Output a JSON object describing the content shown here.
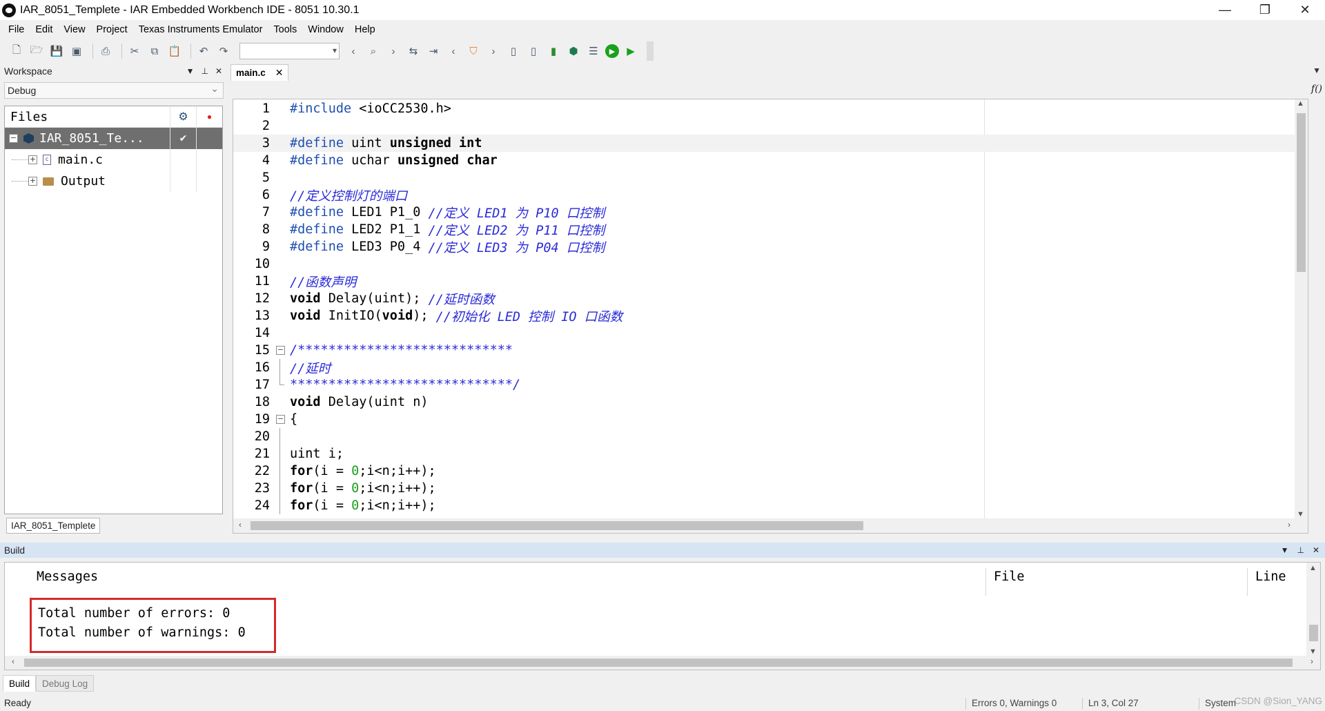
{
  "window": {
    "title": "IAR_8051_Templete - IAR Embedded Workbench IDE - 8051 10.30.1",
    "minimize": "—",
    "maximize": "❐",
    "close": "✕"
  },
  "menu": [
    "File",
    "Edit",
    "View",
    "Project",
    "Texas Instruments Emulator",
    "Tools",
    "Window",
    "Help"
  ],
  "workspace": {
    "title": "Workspace",
    "configuration": "Debug",
    "tree_header": "Files",
    "project": "IAR_8051_Te...",
    "items": [
      "main.c",
      "Output"
    ],
    "tab": "IAR_8051_Templete",
    "icons": {
      "settings": "gear-icon",
      "breakpoint": "red-dot-icon",
      "checked": "check-icon"
    }
  },
  "editor": {
    "tab": "main.c",
    "func_button": "f()",
    "lines": [
      {
        "n": "1",
        "fold": "",
        "tokens": [
          {
            "t": "pp",
            "v": "#include"
          },
          {
            "t": "tx",
            "v": " <ioCC2530.h>"
          }
        ]
      },
      {
        "n": "2",
        "fold": "",
        "tokens": []
      },
      {
        "n": "3",
        "fold": "",
        "tokens": [
          {
            "t": "pp",
            "v": "#define"
          },
          {
            "t": "tx",
            "v": " uint "
          },
          {
            "t": "kw",
            "v": "unsigned"
          },
          {
            "t": "tx",
            "v": " "
          },
          {
            "t": "kw",
            "v": "int"
          }
        ]
      },
      {
        "n": "4",
        "fold": "",
        "tokens": [
          {
            "t": "pp",
            "v": "#define"
          },
          {
            "t": "tx",
            "v": " uchar "
          },
          {
            "t": "kw",
            "v": "unsigned"
          },
          {
            "t": "tx",
            "v": " "
          },
          {
            "t": "kw",
            "v": "char"
          }
        ]
      },
      {
        "n": "5",
        "fold": "",
        "tokens": []
      },
      {
        "n": "6",
        "fold": "",
        "tokens": [
          {
            "t": "cm",
            "v": "//定义控制灯的端口"
          }
        ]
      },
      {
        "n": "7",
        "fold": "",
        "tokens": [
          {
            "t": "pp",
            "v": "#define"
          },
          {
            "t": "tx",
            "v": " LED1 P1_0 "
          },
          {
            "t": "cm",
            "v": "//定义 LED1 为 P10 口控制"
          }
        ]
      },
      {
        "n": "8",
        "fold": "",
        "tokens": [
          {
            "t": "pp",
            "v": "#define"
          },
          {
            "t": "tx",
            "v": " LED2 P1_1 "
          },
          {
            "t": "cm",
            "v": "//定义 LED2 为 P11 口控制"
          }
        ]
      },
      {
        "n": "9",
        "fold": "",
        "tokens": [
          {
            "t": "pp",
            "v": "#define"
          },
          {
            "t": "tx",
            "v": " LED3 P0_4 "
          },
          {
            "t": "cm",
            "v": "//定义 LED3 为 P04 口控制"
          }
        ]
      },
      {
        "n": "10",
        "fold": "",
        "tokens": []
      },
      {
        "n": "11",
        "fold": "",
        "tokens": [
          {
            "t": "cm",
            "v": "//函数声明"
          }
        ]
      },
      {
        "n": "12",
        "fold": "",
        "tokens": [
          {
            "t": "kw",
            "v": "void"
          },
          {
            "t": "tx",
            "v": " Delay(uint); "
          },
          {
            "t": "cm",
            "v": "//延时函数"
          }
        ]
      },
      {
        "n": "13",
        "fold": "",
        "tokens": [
          {
            "t": "kw",
            "v": "void"
          },
          {
            "t": "tx",
            "v": " InitIO("
          },
          {
            "t": "kw",
            "v": "void"
          },
          {
            "t": "tx",
            "v": "); "
          },
          {
            "t": "cm",
            "v": "//初始化 LED 控制 IO 口函数"
          }
        ]
      },
      {
        "n": "14",
        "fold": "",
        "tokens": []
      },
      {
        "n": "15",
        "fold": "box",
        "tokens": [
          {
            "t": "cm",
            "v": "/****************************"
          }
        ]
      },
      {
        "n": "16",
        "fold": "line",
        "tokens": [
          {
            "t": "cm",
            "v": "//延时"
          }
        ]
      },
      {
        "n": "17",
        "fold": "end",
        "tokens": [
          {
            "t": "cm",
            "v": "*****************************/"
          }
        ]
      },
      {
        "n": "18",
        "fold": "",
        "tokens": [
          {
            "t": "kw",
            "v": "void"
          },
          {
            "t": "tx",
            "v": " Delay(uint n)"
          }
        ]
      },
      {
        "n": "19",
        "fold": "box",
        "tokens": [
          {
            "t": "tx",
            "v": "{"
          }
        ]
      },
      {
        "n": "20",
        "fold": "line",
        "tokens": []
      },
      {
        "n": "21",
        "fold": "line",
        "tokens": [
          {
            "t": "tx",
            "v": "uint i;"
          }
        ]
      },
      {
        "n": "22",
        "fold": "line",
        "tokens": [
          {
            "t": "kw",
            "v": "for"
          },
          {
            "t": "tx",
            "v": "(i = "
          },
          {
            "t": "num",
            "v": "0"
          },
          {
            "t": "tx",
            "v": ";i<n;i++);"
          }
        ]
      },
      {
        "n": "23",
        "fold": "line",
        "tokens": [
          {
            "t": "kw",
            "v": "for"
          },
          {
            "t": "tx",
            "v": "(i = "
          },
          {
            "t": "num",
            "v": "0"
          },
          {
            "t": "tx",
            "v": ";i<n;i++);"
          }
        ]
      },
      {
        "n": "24",
        "fold": "line",
        "tokens": [
          {
            "t": "kw",
            "v": "for"
          },
          {
            "t": "tx",
            "v": "(i = "
          },
          {
            "t": "num",
            "v": "0"
          },
          {
            "t": "tx",
            "v": ";i<n;i++);"
          }
        ]
      }
    ],
    "current_line": 3
  },
  "build": {
    "title": "Build",
    "columns": {
      "messages": "Messages",
      "file": "File",
      "line": "Line"
    },
    "messages": [
      "Total number of errors: 0",
      "Total number of warnings: 0"
    ],
    "highlight_color": "#d42a2a",
    "tabs": [
      "Build",
      "Debug Log"
    ]
  },
  "status": {
    "ready": "Ready",
    "errors": "Errors 0, Warnings 0",
    "position": "Ln 3, Col 27",
    "system": "System",
    "watermark": "CSDN @Sion_YANG"
  }
}
